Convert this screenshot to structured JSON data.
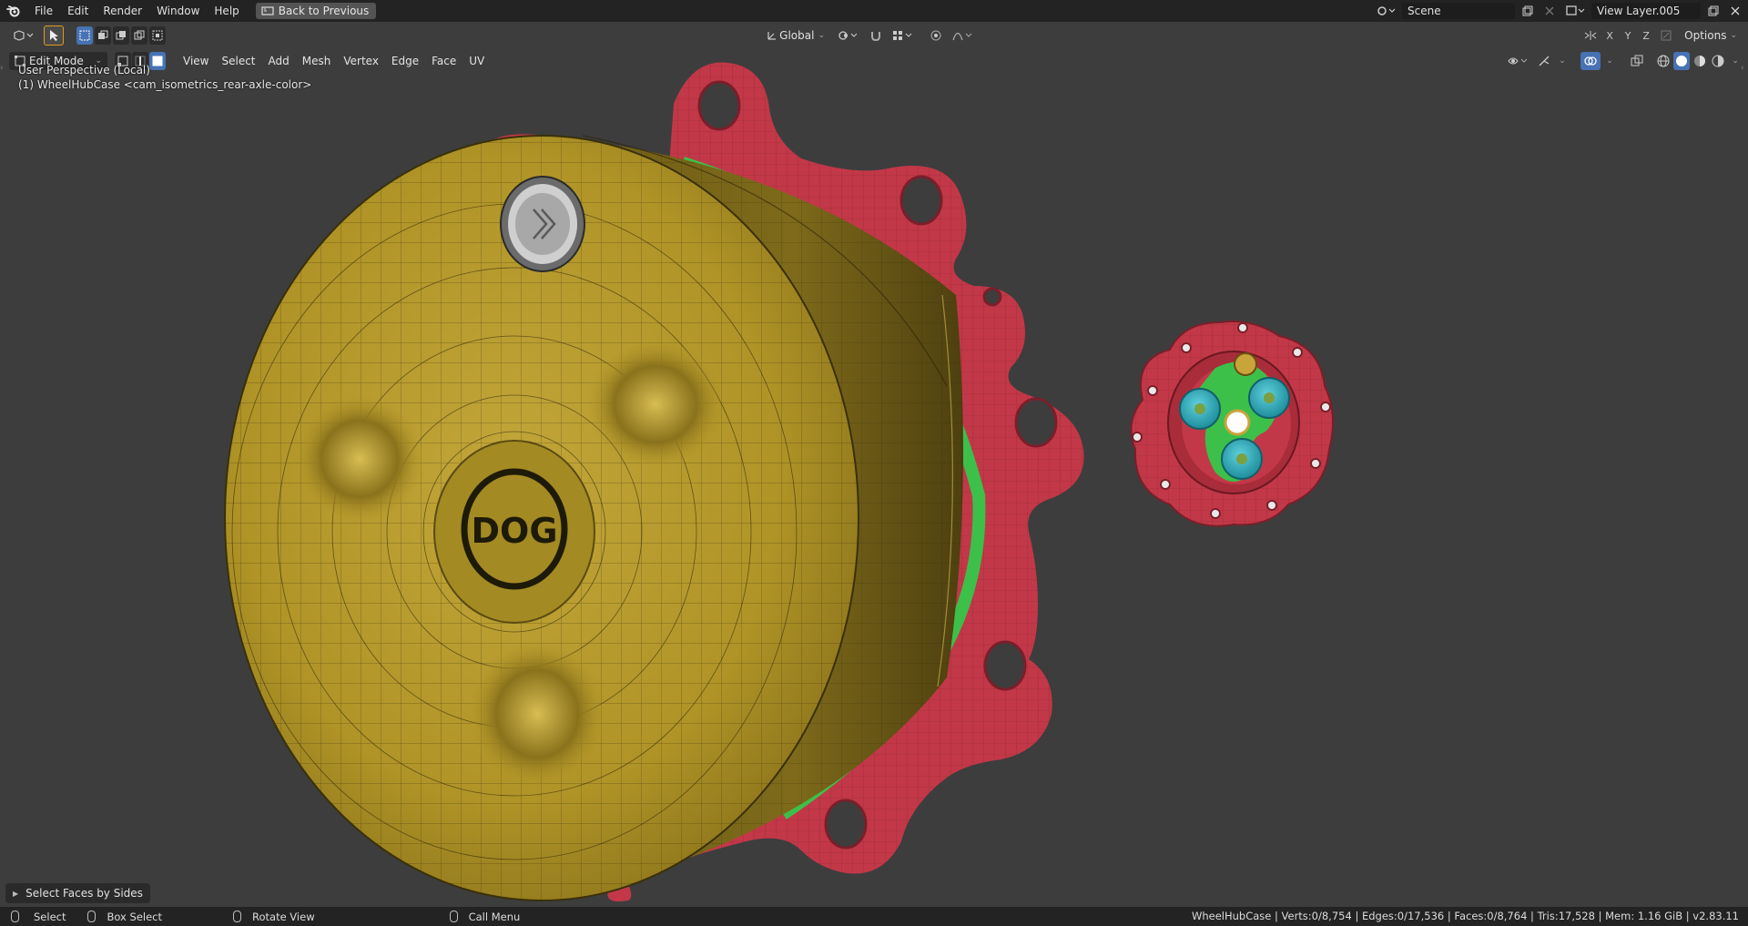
{
  "topbar": {
    "menus": [
      "File",
      "Edit",
      "Render",
      "Window",
      "Help"
    ],
    "back_label": "Back to Previous",
    "scene_name": "Scene",
    "view_layer": "View Layer.005"
  },
  "header": {
    "orientation": "Global",
    "mode": "Edit Mode",
    "menus": [
      "View",
      "Select",
      "Add",
      "Mesh",
      "Vertex",
      "Edge",
      "Face",
      "UV"
    ],
    "axes": [
      "X",
      "Y",
      "Z"
    ],
    "options_label": "Options"
  },
  "viewport": {
    "perspective_label": "User Perspective (Local)",
    "object_label": "(1) WheelHubCase <cam_isometrics_rear-axle-color>",
    "logo_text": "DOG"
  },
  "operator_panel": {
    "label": "Select Faces by Sides"
  },
  "statusbar": {
    "select": "Select",
    "box_select": "Box Select",
    "rotate_view": "Rotate View",
    "call_menu": "Call Menu",
    "stats": "WheelHubCase | Verts:0/8,754 | Edges:0/17,536 | Faces:0/8,764 | Tris:17,528 | Mem: 1.16 GiB | v2.83.11"
  },
  "colors": {
    "viewport_bg": "#3d3d3d",
    "hub_yellow": "#b49a2a",
    "flange_red": "#c33a4a",
    "seal_green": "#3cc04a",
    "cap_cyan": "#2aa8b8"
  }
}
